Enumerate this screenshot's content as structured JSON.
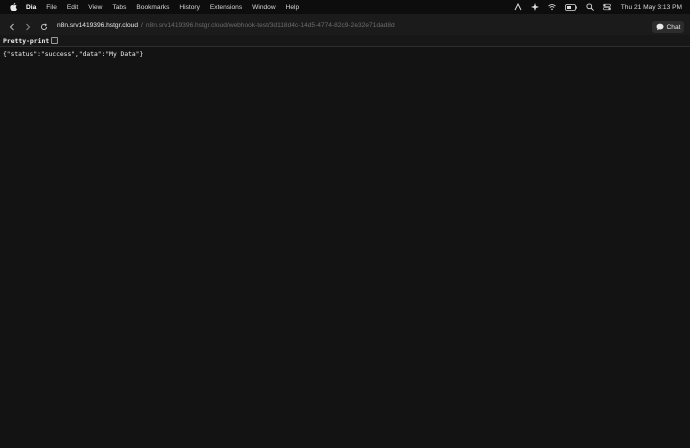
{
  "menubar": {
    "app_name": "Dia",
    "items": [
      "File",
      "Edit",
      "View",
      "Tabs",
      "Bookmarks",
      "History",
      "Extensions",
      "Window",
      "Help"
    ],
    "clock": "Thu 21 May  3:13 PM"
  },
  "toolbar": {
    "url_host": "n8n.srv1419396.hstgr.cloud",
    "url_separator": "/",
    "url_full": "n8n.srv1419396.hstgr.cloud/webhook-test/3d118d4c-14d5-4774-82c9-2e32e71dad8d",
    "chat_label": "Chat"
  },
  "viewer": {
    "pretty_print_label": "Pretty-print",
    "pretty_print_checked": false,
    "content": "{\"status\":\"success\",\"data\":\"My Data\"}"
  }
}
